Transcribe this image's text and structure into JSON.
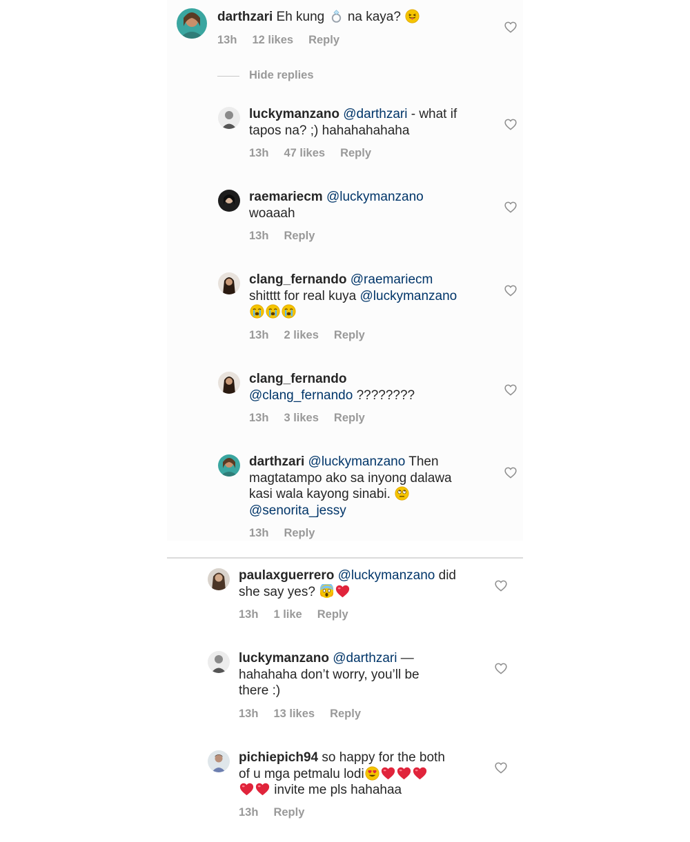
{
  "top_comment": {
    "username": "darthzari",
    "text_before": "Eh kung",
    "text_after": "na kaya?",
    "emoji_ring": "ring-emoji",
    "emoji_tongue": "tongue-face-emoji",
    "time": "13h",
    "likes": "12 likes",
    "reply": "Reply"
  },
  "hide_replies": "Hide replies",
  "replies": [
    {
      "username": "luckymanzano",
      "mention": "@darthzari",
      "line1_rest": "- what if",
      "line2": "tapos na? ;) hahahahahaha",
      "time": "13h",
      "likes": "47 likes",
      "reply": "Reply"
    },
    {
      "username": "raemariecm",
      "mention": "@luckymanzano",
      "line2": "woaaah",
      "time": "13h",
      "reply": "Reply"
    },
    {
      "username": "clang_fernando",
      "mention": "@raemariecm",
      "line2_text": "shitttt for real kuya",
      "line2_mention": "@luckymanzano",
      "emoji": "crying-face-emoji",
      "time": "13h",
      "likes": "2 likes",
      "reply": "Reply"
    },
    {
      "username": "clang_fernando",
      "mention": "@clang_fernando",
      "line2_rest": "????????",
      "time": "13h",
      "likes": "3 likes",
      "reply": "Reply"
    },
    {
      "username": "darthzari",
      "mention": "@luckymanzano",
      "line1_rest": "Then",
      "line2": "magtatampo ako sa inyong dalawa",
      "line3": "kasi wala kayong sinabi.",
      "emoji": "eye-roll-emoji",
      "line4_mention": "@senorita_jessy",
      "time": "13h",
      "reply": "Reply"
    }
  ],
  "comments": [
    {
      "username": "paulaxguerrero",
      "mention": "@luckymanzano",
      "line1_rest": "did",
      "line2": "she say yes?",
      "emojis": [
        "scream-emoji",
        "red-heart-emoji"
      ],
      "time": "13h",
      "likes": "1 like",
      "reply": "Reply"
    },
    {
      "username": "luckymanzano",
      "mention": "@darthzari",
      "line1_rest": "—",
      "line2": "hahahaha don’t worry, you’ll be",
      "line3": "there :)",
      "time": "13h",
      "likes": "13 likes",
      "reply": "Reply"
    },
    {
      "username": "pichiepich94",
      "line1_rest": "so happy for the both",
      "line2": "of u mga petmalu lodi",
      "line2_emojis": [
        "heart-eyes-emoji",
        "red-heart-emoji",
        "red-heart-emoji",
        "red-heart-emoji"
      ],
      "line3_emojis": [
        "red-heart-emoji",
        "red-heart-emoji"
      ],
      "line3": "invite me pls hahahaa",
      "time": "13h",
      "reply": "Reply"
    }
  ],
  "colors": {
    "text": "#262626",
    "mention": "#003569",
    "meta": "#999999",
    "heart_outline": "#8e8e8e",
    "red_heart": "#e0243b",
    "emoji_yellow": "#f5c400",
    "panel_bg": "#fcfcfc"
  },
  "icons": {
    "like": "heart-outline-icon"
  }
}
